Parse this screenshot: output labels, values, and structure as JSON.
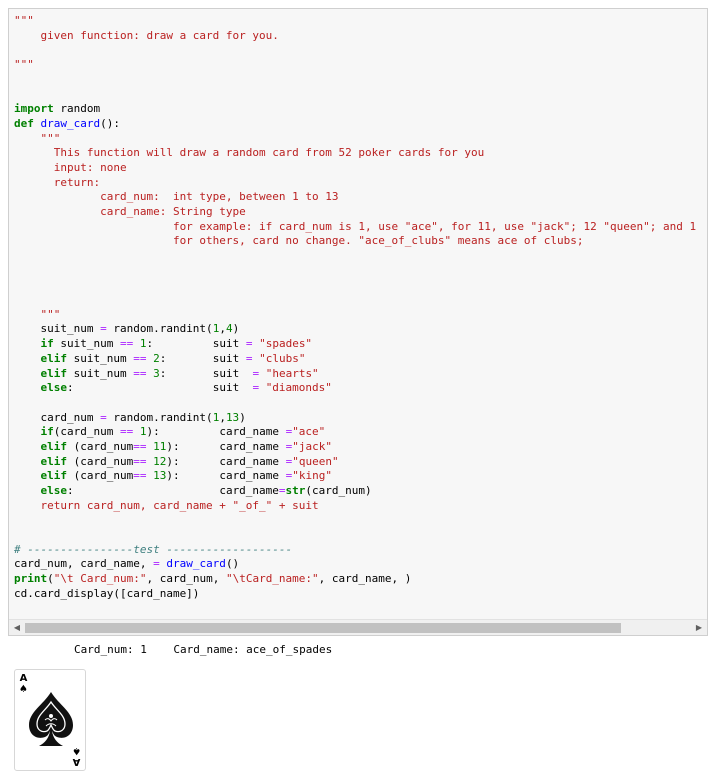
{
  "code_cell": {
    "lines": [
      "\"\"\"",
      "    given function: draw a card for you.",
      "",
      "\"\"\"",
      "",
      "",
      "import random",
      "def draw_card():",
      "    \"\"\"",
      "      This function will draw a random card from 52 poker cards for you",
      "      input: none",
      "      return:",
      "             card_num:  int type, between 1 to 13",
      "             card_name: String type",
      "                        for example: if card_num is 1, use \"ace\", for 11, use \"jack\"; 12 \"queen\"; and 1",
      "                        for others, card no change. \"ace_of_clubs\" means ace of clubs;",
      "",
      "",
      "",
      "",
      "    \"\"\"",
      "    suit_num = random.randint(1,4)",
      "    if suit_num == 1:         suit = \"spades\"",
      "    elif suit_num == 2:       suit = \"clubs\"",
      "    elif suit_num == 3:       suit  = \"hearts\"",
      "    else:                     suit  = \"diamonds\"",
      "",
      "    card_num = random.randint(1,13)",
      "    if(card_num == 1):         card_name =\"ace\"",
      "    elif (card_num== 11):      card_name =\"jack\"",
      "    elif (card_num== 12):      card_name =\"queen\"",
      "    elif (card_num== 13):      card_name =\"king\"",
      "    else:                      card_name=str(card_num)",
      "    return card_num, card_name + \"_of_\" + suit",
      "",
      "",
      "# ----------------test -------------------",
      "card_num, card_name, = draw_card()",
      "print(\"\\t Card_num:\", card_num, \"\\tCard_name:\", card_name, )",
      "cd.card_display([card_name])"
    ]
  },
  "scrollbar": {
    "left_icon": "chevron-left-icon",
    "right_icon": "chevron-right-icon"
  },
  "output": {
    "text": "Card_num: 1    Card_name: ace_of_spades"
  },
  "card": {
    "rank": "A",
    "suit_symbol": "♠",
    "suit": "spades"
  }
}
